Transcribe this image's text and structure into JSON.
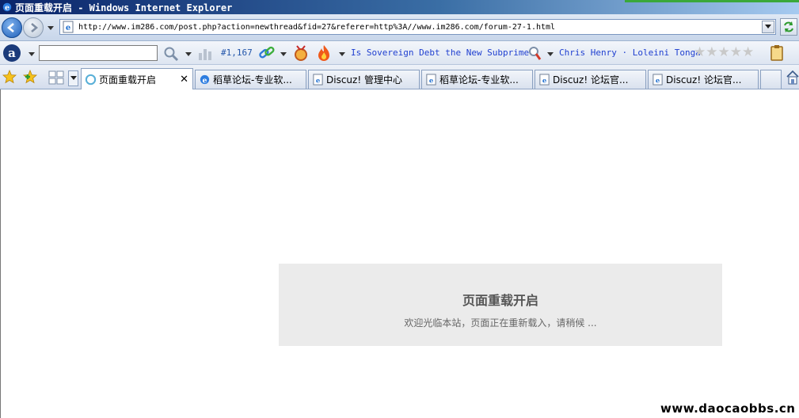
{
  "window": {
    "title": "页面重载开启 - Windows Internet Explorer"
  },
  "address_bar": {
    "url": "http://www.im286.com/post.php?action=newthread&fid=27&referer=http%3A//www.im286.com/forum-27-1.html"
  },
  "toolbar": {
    "rank_text": "#1,167",
    "link1": "Is Sovereign Debt the New Subprime?",
    "link2": "Chris Henry · Loleini Tonga",
    "amazon_letter": "a"
  },
  "tabs": [
    {
      "label": "页面重载开启",
      "icon": "loading-icon",
      "active": true
    },
    {
      "label": "稻草论坛-专业软...",
      "icon": "ie-page-icon",
      "active": false
    },
    {
      "label": "Discuz! 管理中心",
      "icon": "page-icon",
      "active": false
    },
    {
      "label": "稻草论坛-专业软...",
      "icon": "page-icon",
      "active": false
    },
    {
      "label": "Discuz! 论坛官...",
      "icon": "page-icon",
      "active": false
    },
    {
      "label": "Discuz! 论坛官...",
      "icon": "page-icon",
      "active": false
    }
  ],
  "content": {
    "notice_title": "页面重载开启",
    "notice_message": "欢迎光临本站，页面正在重新载入，请稍候 ..."
  },
  "watermark": "www.daocaobbs.cn",
  "colors": {
    "link": "#1f3fd0",
    "notice_bg": "#ebebeb",
    "titlebar": "#0a246a"
  }
}
